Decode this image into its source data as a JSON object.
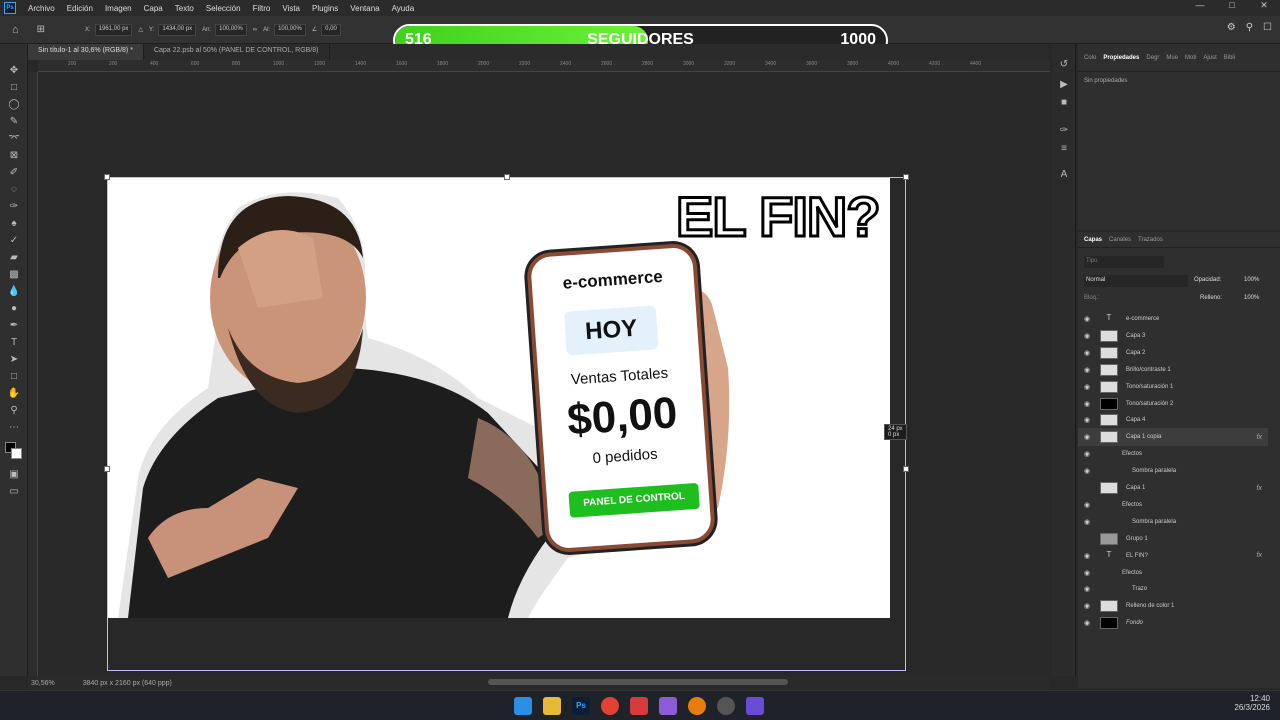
{
  "menu": [
    "Archivo",
    "Edición",
    "Imagen",
    "Capa",
    "Texto",
    "Selección",
    "Filtro",
    "Vista",
    "Plugins",
    "Ventana",
    "Ayuda"
  ],
  "options": {
    "x": "1961,00 px",
    "y": "1434,00 px",
    "an": "100,00%",
    "al": "100,00%",
    "angle": "0,00"
  },
  "followers": {
    "current": "516",
    "label": "SEGUIDORES",
    "goal": "1000",
    "progress": 0.516
  },
  "tabs": [
    {
      "label": "Sin título-1 al 30,6% (RGB/8) *"
    },
    {
      "label": "Capa 22.psb al 50% (PANEL DE CONTROL, RGB/8)"
    }
  ],
  "ruler": [
    "200",
    "200",
    "400",
    "600",
    "800",
    "1000",
    "1200",
    "1400",
    "1600",
    "1800",
    "2000",
    "2200",
    "2400",
    "2600",
    "2800",
    "3000",
    "3200",
    "3400",
    "3600",
    "3800",
    "4000",
    "4200",
    "4400"
  ],
  "artboard": {
    "title": "EL FIN?",
    "phone_brand": "e-commerce",
    "hoy": "HOY",
    "ventas_label": "Ventas Totales",
    "amount": "$0,00",
    "orders": "0 pedidos",
    "button": "PANEL DE CONTROL"
  },
  "transform_tip": {
    "w": "24 px",
    "h": "0 px"
  },
  "status": {
    "zoom": "30,56%",
    "dims": "3840 px x 2160 px (640 ppp)"
  },
  "props": {
    "tabs": [
      "Colo",
      "Propiedades",
      "Degr",
      "Mue",
      "Moti",
      "Ajust",
      "Bibli"
    ],
    "empty": "Sin propiedades"
  },
  "layers": {
    "tabs": [
      "Capas",
      "Canales",
      "Trazados"
    ],
    "filter_placeholder": "Tipo",
    "blend": "Normal",
    "opacity_label": "Opacidad:",
    "opacity": "100%",
    "fill_label": "Relleno:",
    "fill": "100%",
    "lock_label": "Bloq.:",
    "items": [
      {
        "name": "e-commerce",
        "kind": "text"
      },
      {
        "name": "Capa 3",
        "kind": "img"
      },
      {
        "name": "Capa 2",
        "kind": "img"
      },
      {
        "name": "Brillo/contraste 1",
        "kind": "adj"
      },
      {
        "name": "Tono/saturación 1",
        "kind": "adj"
      },
      {
        "name": "Tono/saturación 2",
        "kind": "adj"
      },
      {
        "name": "Capa 4",
        "kind": "img"
      },
      {
        "name": "Capa 1 copia",
        "kind": "img"
      },
      {
        "name": "Efectos",
        "kind": "sub"
      },
      {
        "name": "Sombra paralela",
        "kind": "sub2"
      },
      {
        "name": "Capa 1",
        "kind": "img"
      },
      {
        "name": "Efectos",
        "kind": "sub"
      },
      {
        "name": "Sombra paralela",
        "kind": "sub2"
      },
      {
        "name": "Grupo 1",
        "kind": "group"
      },
      {
        "name": "EL FIN?",
        "kind": "text"
      },
      {
        "name": "Efectos",
        "kind": "sub"
      },
      {
        "name": "Trazo",
        "kind": "sub2"
      },
      {
        "name": "Relleno de color 1",
        "kind": "fill"
      },
      {
        "name": "Fondo",
        "kind": "bg"
      }
    ]
  },
  "clock": {
    "time": "12:40",
    "date": "26/3/2026"
  },
  "colors": {
    "accent": "#31a8ff",
    "green": "#3fd11c",
    "button": "#1fbe1f"
  }
}
